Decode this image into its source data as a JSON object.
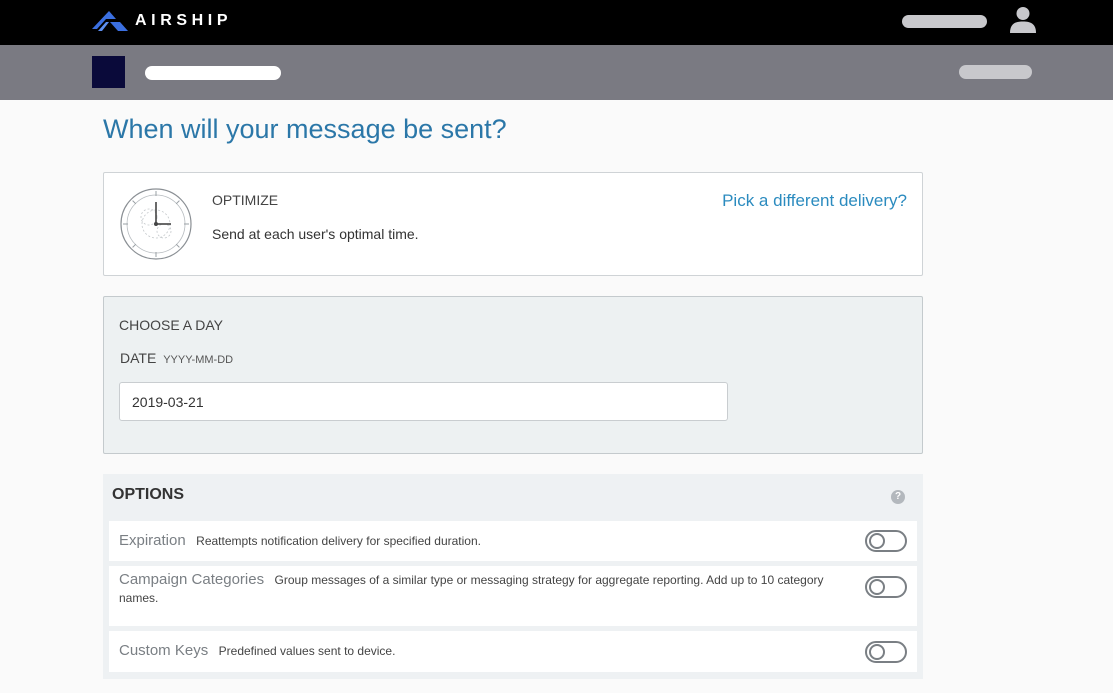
{
  "brand": {
    "name": "AIRSHIP",
    "accent": "#2b77a8",
    "logo_color": "#3b6fe0"
  },
  "header": {
    "user_icon": "user-icon"
  },
  "page": {
    "heading": "When will your message be sent?"
  },
  "delivery": {
    "icon": "clock-icon",
    "title": "OPTIMIZE",
    "description": "Send at each user's optimal time.",
    "change_link": "Pick a different delivery?"
  },
  "schedule": {
    "title": "CHOOSE A DAY",
    "date_label": "DATE",
    "date_format": "YYYY-MM-DD",
    "date_value": "2019-03-21"
  },
  "options": {
    "title": "OPTIONS",
    "help_icon": "question-icon",
    "rows": [
      {
        "name": "Expiration",
        "description": "Reattempts notification delivery for specified duration.",
        "enabled": false
      },
      {
        "name": "Campaign Categories",
        "description": "Group messages of a similar type or messaging strategy for aggregate reporting. Add up to 10 category names.",
        "enabled": false
      },
      {
        "name": "Custom Keys",
        "description": "Predefined values sent to device.",
        "enabled": false
      }
    ]
  }
}
